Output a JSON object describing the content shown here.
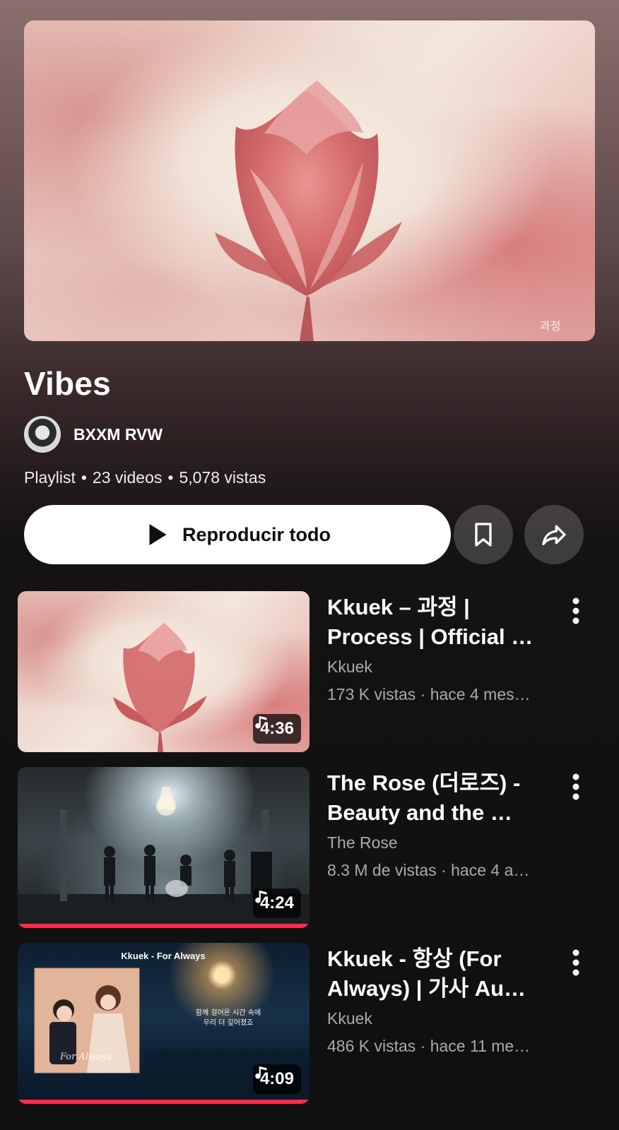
{
  "playlist": {
    "title": "Vibes",
    "owner": "BXXM RVW",
    "type": "Playlist",
    "video_count": "23 videos",
    "views": "5,078 vistas",
    "play_all_label": "Reproducir todo",
    "hero_watermark": "과정"
  },
  "videos": [
    {
      "title": "Kkuek – 과정 | Process | Official …",
      "channel": "Kkuek",
      "meta": "173 K vistas · hace 4 mes…",
      "duration": "4:36",
      "progress": 0
    },
    {
      "title": "The Rose (더로즈) - Beauty and the …",
      "channel": "The Rose",
      "meta": "8.3 M de vistas · hace 4 a…",
      "duration": "4:24",
      "progress": 1.0
    },
    {
      "title": "Kkuek - 항상 (For Always) | 가사 Au…",
      "channel": "Kkuek",
      "meta": "486 K vistas · hace 11 me…",
      "duration": "4:09",
      "progress": 1.0,
      "thumb_caption": "Kkuek - For Always",
      "thumb_lyrics_1": "함께 걸어온 시간 속에",
      "thumb_lyrics_2": "우리 더 깊어졌죠",
      "thumb_script": "For Always"
    }
  ],
  "colors": {
    "progress": "#ff2b4a",
    "accent_button": "#ffffff"
  },
  "icons": [
    "play-icon",
    "save-playlist-icon",
    "share-icon",
    "music-note-icon",
    "more-vert-icon"
  ]
}
